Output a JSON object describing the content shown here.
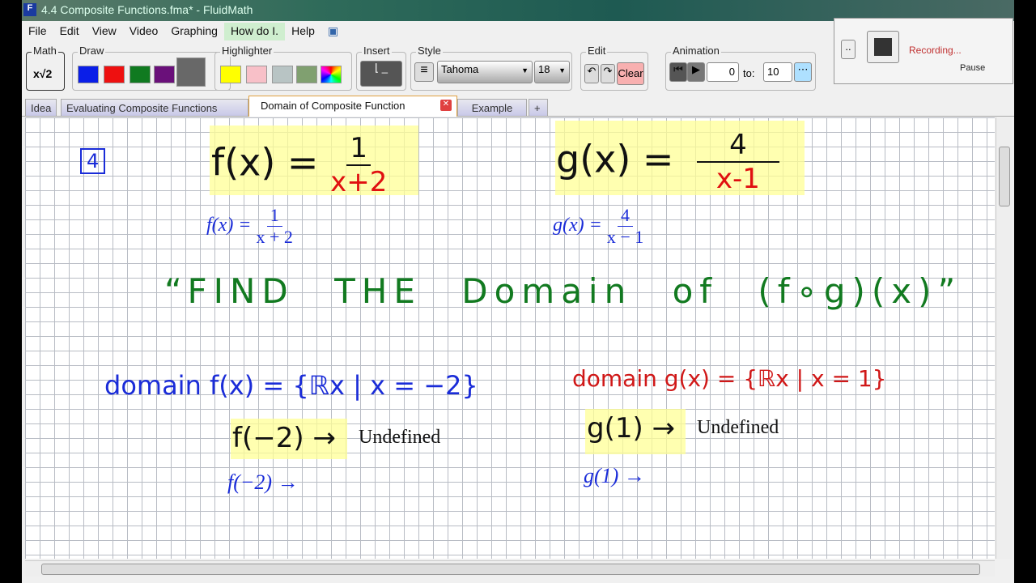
{
  "window": {
    "title": "4.4 Composite Functions.fma* - FluidMath",
    "app_icon": "F"
  },
  "menu": [
    "File",
    "Edit",
    "View",
    "Video",
    "Graphing",
    "How do I.",
    "Help"
  ],
  "toolbar": {
    "math_label": "Math",
    "math_icon": "x√2",
    "draw_label": "Draw",
    "draw_colors": [
      "#0a1ee8",
      "#ee1010",
      "#107a20",
      "#6a107a",
      "#686868"
    ],
    "highlighter_label": "Highlighter",
    "highlighter_colors": [
      "#ffff00",
      "#f8c0c8",
      "#b8c4c4",
      "#80a070"
    ],
    "insert_label": "Insert",
    "style_label": "Style",
    "font": "Tahoma",
    "font_size": "18",
    "edit_label": "Edit",
    "clear_label": "Clear",
    "animation_label": "Animation",
    "anim_from": "0",
    "anim_to_label": "to:",
    "anim_to": "10"
  },
  "recording": {
    "status": "Recording...",
    "pause_label": "Pause",
    "more_label": ".."
  },
  "tabs": [
    {
      "label": "Idea"
    },
    {
      "label": "Evaluating Composite Functions"
    },
    {
      "label": "Domain of Composite Function",
      "active": true
    },
    {
      "label": "Example"
    },
    {
      "label": "+"
    }
  ],
  "canvas": {
    "problem_number": "4",
    "f_hand": {
      "lhs": "f(x) =",
      "num": "1",
      "den": "x+2"
    },
    "g_hand": {
      "lhs": "g(x) =",
      "num": "4",
      "den": "x-1"
    },
    "f_typed": {
      "lhs": "f(x) =",
      "num": "1",
      "den": "x + 2"
    },
    "g_typed": {
      "lhs": "g(x) =",
      "num": "4",
      "den": "x − 1"
    },
    "question": "“FIND THE Domain of (f∘g)(x)”",
    "domain_f": "domain f(x) = {ℝx | x = −2}",
    "domain_g": "domain g(x) = {ℝx | x = 1}",
    "f_eval_hand": "f(−2) →",
    "f_eval_result": "Undefined",
    "f_eval_typed": "f(−2) →",
    "g_eval_hand": "g(1) →",
    "g_eval_result": "Undefined",
    "g_eval_typed": "g(1) →"
  }
}
